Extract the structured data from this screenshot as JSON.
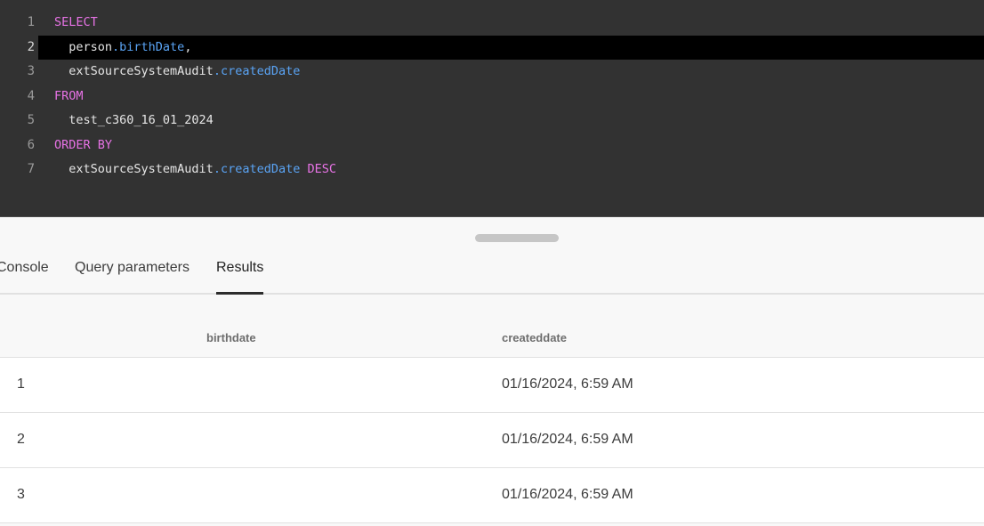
{
  "editor": {
    "lines": [
      {
        "number": "1",
        "tokens": [
          {
            "text": "SELECT",
            "kind": "kw"
          }
        ]
      },
      {
        "number": "2",
        "tokens": [
          {
            "text": "  person",
            "kind": "plain"
          },
          {
            "text": ".birthDate",
            "kind": "prop"
          },
          {
            "text": ",",
            "kind": "plain"
          }
        ]
      },
      {
        "number": "3",
        "tokens": [
          {
            "text": "  extSourceSystemAudit",
            "kind": "plain"
          },
          {
            "text": ".createdDate",
            "kind": "prop"
          }
        ]
      },
      {
        "number": "4",
        "tokens": [
          {
            "text": "FROM",
            "kind": "kw"
          }
        ]
      },
      {
        "number": "5",
        "tokens": [
          {
            "text": "  test_c360_16_01_2024",
            "kind": "plain"
          }
        ]
      },
      {
        "number": "6",
        "tokens": [
          {
            "text": "ORDER BY",
            "kind": "kw"
          }
        ]
      },
      {
        "number": "7",
        "tokens": [
          {
            "text": "  extSourceSystemAudit",
            "kind": "plain"
          },
          {
            "text": ".createdDate",
            "kind": "prop"
          },
          {
            "text": " DESC",
            "kind": "kw"
          }
        ]
      }
    ],
    "active_line": 2,
    "colors": {
      "keyword": "#e873e6",
      "property": "#5aa4f5",
      "plain": "#e6e6e6",
      "background": "#323232"
    }
  },
  "tabs": {
    "console": "Console",
    "query_parameters": "Query parameters",
    "results": "Results",
    "selected": "Results"
  },
  "results": {
    "columns": {
      "birthdate": "birthdate",
      "createddate": "createddate"
    },
    "rows": [
      {
        "index": "1",
        "birthdate": "",
        "createddate": "01/16/2024, 6:59 AM"
      },
      {
        "index": "2",
        "birthdate": "",
        "createddate": "01/16/2024, 6:59 AM"
      },
      {
        "index": "3",
        "birthdate": "",
        "createddate": "01/16/2024, 6:59 AM"
      }
    ]
  }
}
